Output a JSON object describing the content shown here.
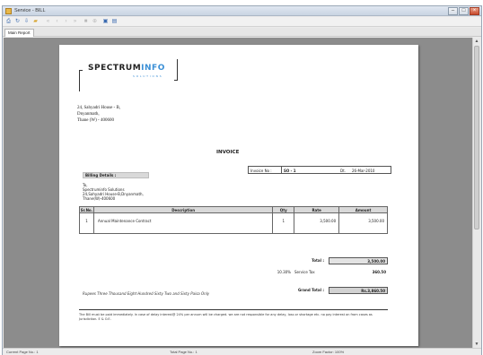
{
  "window": {
    "title": "Service - BILL"
  },
  "toolbar": {
    "icons": [
      "print-icon",
      "refresh-icon",
      "export-icon",
      "open-icon",
      "first-page-icon",
      "prev-page-icon",
      "next-page-icon",
      "last-page-icon",
      "stop-icon",
      "zoom-icon",
      "print-layout-icon",
      "layout-options-icon"
    ]
  },
  "tab": {
    "label": "Main Report"
  },
  "invoice": {
    "logo_main": "SPECTRUM",
    "logo_accent": "INFO",
    "logo_sub": "SOLUTIONS",
    "address": [
      "24, Sahyadri House - B,",
      "Dnyanmath,",
      "Thane (W) - 400600"
    ],
    "title": "INVOICE",
    "billing_label": "Billing Details :",
    "bill_to": [
      "To,",
      "Spectruminfo Solutions",
      "24,Sahyadri House-B,Dnyanmath,",
      "Thane(W)-400600"
    ],
    "invoice_no_label": "Invoice No :",
    "invoice_no": "SO - 1",
    "date_label": "Dt.",
    "date": "26-Mar-2010",
    "columns": [
      "Sr.No.",
      "Description",
      "Qty",
      "Rate",
      "Amount"
    ],
    "rows": [
      {
        "sr": "1",
        "desc": "Annual Maintenance Contract",
        "qty": "1",
        "rate": "3,500.00",
        "amount": "3,500.00"
      }
    ],
    "total_label": "Total :",
    "total": "3,500.00",
    "tax_rate": "10.30%",
    "tax_label": "Service Tax",
    "tax_amount": "360.50",
    "grand_label": "Grand Total :",
    "grand_total": "Rs.3,860.50",
    "amount_words": "Rupees Three Thousand Eight Hundred Sixty Two and Sixty Paisa Only",
    "note": "The Bill must be paid immediately. In case of delay interest@ 24% per annum will be charged. we are not responsible for any delay, loss or shortage etc. no pay interest on from cases as Jurisdiction. E & O.E."
  },
  "status": {
    "current_page": "Current Page No.: 1",
    "total_page": "Total Page No.: 1",
    "zoom": "Zoom Factor: 100%"
  }
}
